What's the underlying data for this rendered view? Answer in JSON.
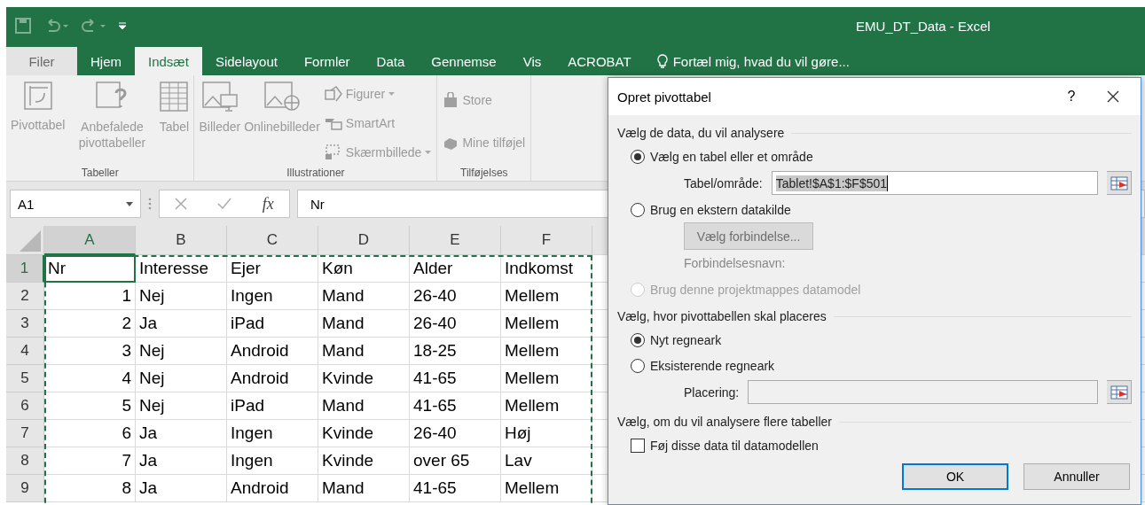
{
  "window": {
    "title": "EMU_DT_Data - Excel"
  },
  "tabs": [
    {
      "label": "Filer",
      "selected": false,
      "kind": "file"
    },
    {
      "label": "Hjem",
      "selected": false,
      "kind": "tab"
    },
    {
      "label": "Indsæt",
      "selected": true,
      "kind": "tab"
    },
    {
      "label": "Sidelayout",
      "selected": false,
      "kind": "tab"
    },
    {
      "label": "Formler",
      "selected": false,
      "kind": "tab"
    },
    {
      "label": "Data",
      "selected": false,
      "kind": "tab"
    },
    {
      "label": "Gennemse",
      "selected": false,
      "kind": "tab"
    },
    {
      "label": "Vis",
      "selected": false,
      "kind": "tab"
    },
    {
      "label": "ACROBAT",
      "selected": false,
      "kind": "tab"
    }
  ],
  "tell_me": {
    "placeholder": "Fortæl mig, hvad du vil gøre..."
  },
  "ribbon": {
    "groups": [
      {
        "label": "Tabeller",
        "items": [
          {
            "label": "Pivottabel",
            "kind": "large"
          },
          {
            "label": "Anbefalede pivottabeller",
            "kind": "large"
          },
          {
            "label": "Tabel",
            "kind": "large"
          }
        ]
      },
      {
        "label": "Illustrationer",
        "items": [
          {
            "label": "Billeder",
            "kind": "large"
          },
          {
            "label": "Onlinebilleder",
            "kind": "large"
          },
          {
            "label": "Figurer",
            "kind": "small",
            "dropdown": true
          },
          {
            "label": "SmartArt",
            "kind": "small",
            "dropdown": false
          },
          {
            "label": "Skærmbillede",
            "kind": "small",
            "dropdown": true
          }
        ]
      },
      {
        "label": "Tilføjelses",
        "items": [
          {
            "label": "Store",
            "kind": "small",
            "dropdown": false
          },
          {
            "label": "Mine tilføjel",
            "kind": "small",
            "dropdown": false
          }
        ]
      }
    ]
  },
  "formula_bar": {
    "name_box": "A1",
    "function_label": "fx",
    "value": "Nr"
  },
  "sheet": {
    "columns": [
      {
        "label": "A",
        "selected": true
      },
      {
        "label": "B",
        "selected": false
      },
      {
        "label": "C",
        "selected": false
      },
      {
        "label": "D",
        "selected": false
      },
      {
        "label": "E",
        "selected": false
      },
      {
        "label": "F",
        "selected": false
      }
    ],
    "rows": [
      {
        "label": "1",
        "selected": true,
        "cells": [
          "Nr",
          "Interesse",
          "Ejer",
          "Køn",
          "Alder",
          "Indkomst"
        ]
      },
      {
        "label": "2",
        "selected": false,
        "cells": [
          "1",
          "Nej",
          "Ingen",
          "Mand",
          "26-40",
          "Mellem"
        ]
      },
      {
        "label": "3",
        "selected": false,
        "cells": [
          "2",
          "Ja",
          "iPad",
          "Mand",
          "26-40",
          "Mellem"
        ]
      },
      {
        "label": "4",
        "selected": false,
        "cells": [
          "3",
          "Nej",
          "Android",
          "Mand",
          "18-25",
          "Mellem"
        ]
      },
      {
        "label": "5",
        "selected": false,
        "cells": [
          "4",
          "Nej",
          "Android",
          "Kvinde",
          "41-65",
          "Mellem"
        ]
      },
      {
        "label": "6",
        "selected": false,
        "cells": [
          "5",
          "Nej",
          "iPad",
          "Mand",
          "41-65",
          "Mellem"
        ]
      },
      {
        "label": "7",
        "selected": false,
        "cells": [
          "6",
          "Ja",
          "Ingen",
          "Kvinde",
          "26-40",
          "Høj"
        ]
      },
      {
        "label": "8",
        "selected": false,
        "cells": [
          "7",
          "Ja",
          "Ingen",
          "Kvinde",
          "over 65",
          "Lav"
        ]
      },
      {
        "label": "9",
        "selected": false,
        "cells": [
          "8",
          "Ja",
          "Android",
          "Mand",
          "41-65",
          "Mellem"
        ]
      }
    ]
  },
  "dialog": {
    "title": "Opret pivottabel",
    "help": "?",
    "section_data": "Vælg de data, du vil analysere",
    "source_options": [
      {
        "label": "Vælg en tabel eller et område",
        "selected": true,
        "disabled": false
      },
      {
        "label": "Brug en ekstern datakilde",
        "selected": false,
        "disabled": false
      },
      {
        "label": "Brug denne projektmappes datamodel",
        "selected": false,
        "disabled": true
      }
    ],
    "range_label": "Tabel/område:",
    "range_value": "Tablet!$A$1:$F$501",
    "connection_button": {
      "label": "Vælg forbindelse...",
      "disabled": true
    },
    "connection_name_label": "Forbindelsesnavn:",
    "section_place": "Vælg, hvor pivottabellen skal placeres",
    "place_options": [
      {
        "label": "Nyt regneark",
        "selected": true,
        "disabled": false
      },
      {
        "label": "Eksisterende regneark",
        "selected": false,
        "disabled": false
      }
    ],
    "location_label": "Placering:",
    "location_disabled": true,
    "section_multi": "Vælg, om du vil analysere flere tabeller",
    "datamodel_checkbox": {
      "label": "Føj disse data til datamodellen",
      "checked": false
    },
    "buttons": [
      {
        "label": "OK",
        "default": true
      },
      {
        "label": "Annuller",
        "default": false
      }
    ]
  }
}
